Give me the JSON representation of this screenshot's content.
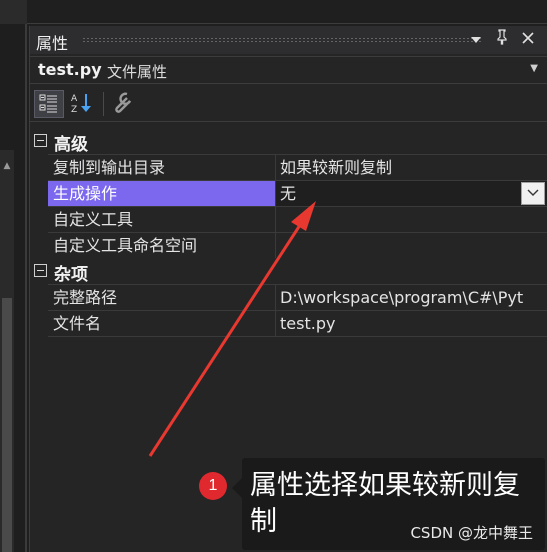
{
  "panel": {
    "title": "属性",
    "dropdown_glyph": "▼",
    "pin_glyph": "📌",
    "close_glyph": "✕"
  },
  "object": {
    "name": "test.py",
    "type": "文件属性"
  },
  "categories": [
    {
      "label": "高级",
      "rows": [
        {
          "name": "复制到输出目录",
          "value": "如果较新则复制"
        },
        {
          "name": "生成操作",
          "value": "无",
          "selected": true
        },
        {
          "name": "自定义工具",
          "value": ""
        },
        {
          "name": "自定义工具命名空间",
          "value": ""
        }
      ]
    },
    {
      "label": "杂项",
      "rows": [
        {
          "name": "完整路径",
          "value": "D:\\workspace\\program\\C#\\Pyt"
        },
        {
          "name": "文件名",
          "value": "test.py"
        }
      ]
    }
  ],
  "annotation": {
    "number": "1",
    "text": "属性选择如果较新则复制",
    "watermark": "CSDN @龙中舞王",
    "arrow_color": "#e8382f"
  },
  "colors": {
    "selected_bg": "#7b68ee",
    "panel_bg": "#252526",
    "badge_bg": "#e0282f"
  }
}
